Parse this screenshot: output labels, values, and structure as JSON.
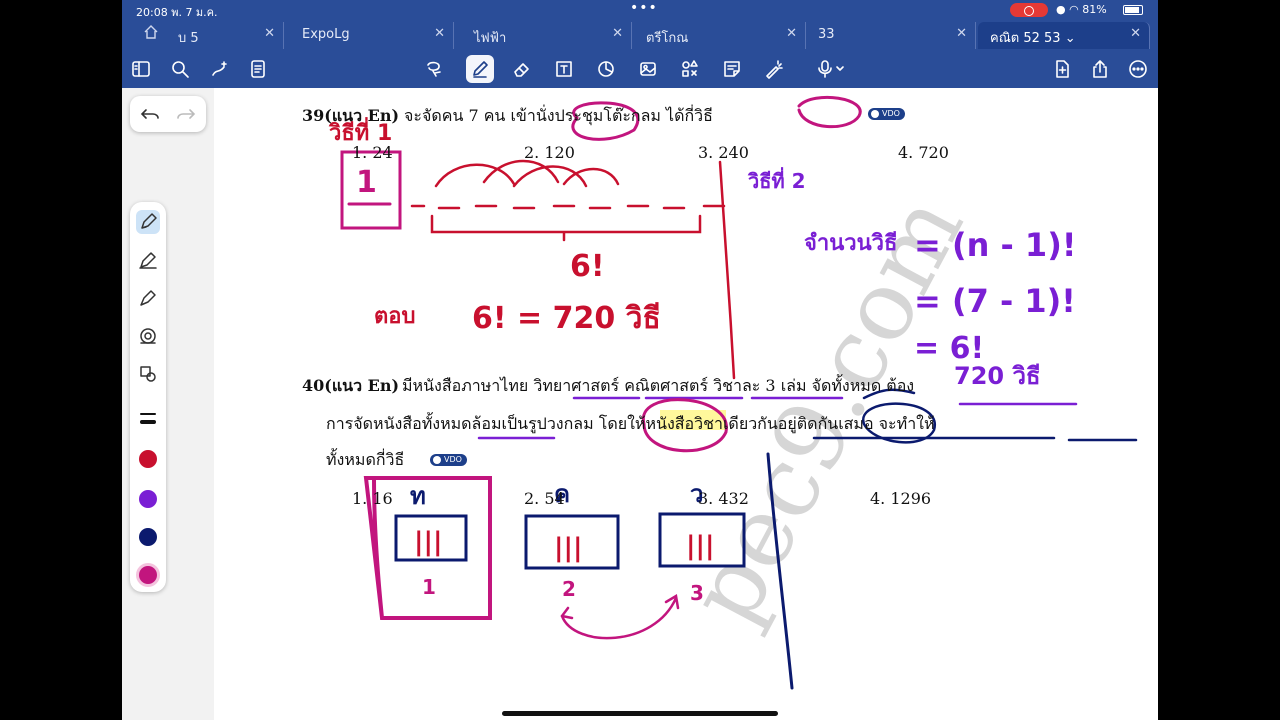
{
  "status": {
    "time": "20:08  พ. 7 ม.ค.",
    "battery": "81%"
  },
  "tabs": [
    {
      "label": "บ 5"
    },
    {
      "label": "ExpoLg"
    },
    {
      "label": "ไฟฟ้า"
    },
    {
      "label": "ตรีโกณ"
    },
    {
      "label": "33"
    },
    {
      "label": "คณิต 52 53"
    }
  ],
  "toolbar": {
    "icons": [
      "sidebar-icon",
      "search-icon",
      "sparkle-pen-icon",
      "document-icon",
      "lasso-icon",
      "pen-icon",
      "eraser-icon",
      "text-box-icon",
      "shapes-icon",
      "image-icon",
      "elements-icon",
      "sticky-note-icon",
      "laser-pointer-icon",
      "microphone-icon",
      "add-page-icon",
      "share-icon",
      "more-icon"
    ]
  },
  "colors": {
    "accent": "#2a4d98",
    "ink_red": "#c8102e",
    "ink_purple": "#7a1fd4",
    "ink_magenta": "#c2157e",
    "ink_navy": "#0b1a6e"
  },
  "q39": {
    "title": "39(แนว En)",
    "text": "จะจัดคน  7  คน  เข้านั่งประชุมโต๊ะกลม ได้กี่วิธี",
    "badge": "VDO",
    "choices": [
      "1.  24",
      "2.  120",
      "3.  240",
      "4.  720"
    ]
  },
  "q40": {
    "title": "40(แนว En)",
    "line1": "มีหนังสือภาษาไทย  วิทยาศาสตร์  คณิตศาสตร์  วิชาละ  3  เล่ม  จัดทั้งหมด  ต้อง",
    "line2": "การจัดหนังสือทั้งหมดล้อมเป็นรูปวงกลม  โดยให้หนังสือวิชาเดียวกันอยู่ติดกันเสมอ  จะทำให้",
    "line3": "ทั้งหมดกี่วิธี",
    "badge": "VDO",
    "choices": [
      "1.  16",
      "2.  54",
      "3.  432",
      "4.  1296"
    ]
  },
  "handwriting": {
    "way1": "วิธีที่ 1",
    "box1": "1",
    "six_fact": "6!",
    "ans_label": "ตอบ",
    "answer": "6!  =  720 วิธี",
    "way2": "วิธีที่ 2",
    "formula_label": "จำนวนวิธี",
    "formula1": "=  (n - 1)!",
    "formula2": "=  (7 - 1)!",
    "formula3": "=  6!",
    "formula4": "720 วิธี",
    "label_th": "ท",
    "label_k": "ค",
    "label_w": "ว",
    "group_mark": "|||",
    "num1": "1",
    "num2": "2",
    "num3": "3"
  },
  "watermark": "pec9.com"
}
